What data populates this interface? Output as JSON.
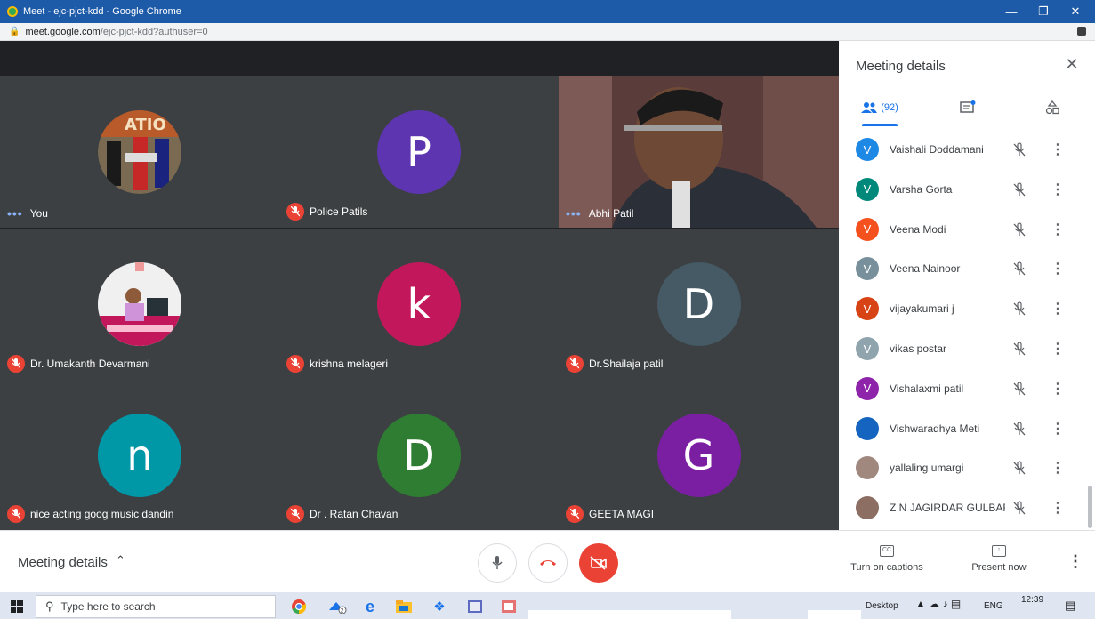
{
  "browser": {
    "window_title": "Meet - ejc-pjct-kdd - Google Chrome",
    "url_host": "meet.google.com",
    "url_path": "/ejc-pjct-kdd?authuser=0"
  },
  "tiles": [
    {
      "name": "You",
      "kind": "photo",
      "status": "talking"
    },
    {
      "name": "Police Patils",
      "kind": "letter",
      "letter": "P",
      "color": "#5e35b1",
      "status": "muted"
    },
    {
      "name": "Abhi Patil",
      "kind": "video",
      "status": "talking"
    },
    {
      "name": "Dr. Umakanth Devarmani",
      "kind": "photo",
      "status": "muted"
    },
    {
      "name": "krishna melageri",
      "kind": "letter",
      "letter": "k",
      "color": "#c2185b",
      "status": "muted"
    },
    {
      "name": "Dr.Shailaja patil",
      "kind": "letter",
      "letter": "D",
      "color": "#455a64",
      "status": "muted"
    },
    {
      "name": "nice acting goog music dandin",
      "kind": "letter",
      "letter": "n",
      "color": "#0097a7",
      "status": "muted"
    },
    {
      "name": "Dr . Ratan Chavan",
      "kind": "letter",
      "letter": "D",
      "color": "#2e7d32",
      "status": "muted"
    },
    {
      "name": "GEETA MAGI",
      "kind": "letter",
      "letter": "G",
      "color": "#7b1fa2",
      "status": "muted"
    }
  ],
  "panel": {
    "title": "Meeting details",
    "people_count": "(92)",
    "participants": [
      {
        "name": "Vaishali Doddamani",
        "letter": "V",
        "color": "#1e88e5"
      },
      {
        "name": "Varsha Gorta",
        "letter": "V",
        "color": "#00897b"
      },
      {
        "name": "Veena Modi",
        "letter": "V",
        "color": "#f4511e"
      },
      {
        "name": "Veena Nainoor",
        "letter": "V",
        "color": "#78909c"
      },
      {
        "name": "vijayakumari j",
        "letter": "V",
        "color": "#d84315"
      },
      {
        "name": "vikas postar",
        "letter": "V",
        "color": "#90a4ae"
      },
      {
        "name": "Vishalaxmi patil",
        "letter": "V",
        "color": "#8e24aa"
      },
      {
        "name": "Vishwaradhya Meti",
        "letter": "",
        "color": "#1565c0"
      },
      {
        "name": "yallaling umargi",
        "letter": "",
        "color": "#a1887f"
      },
      {
        "name": "Z N JAGIRDAR GULBAR...",
        "letter": "",
        "color": "#8d6e63"
      }
    ]
  },
  "bottom": {
    "meeting_details": "Meeting details",
    "captions_label": "Turn on captions",
    "captions_icon": "CC",
    "present_label": "Present now"
  },
  "taskbar": {
    "search_placeholder": "Type here to search",
    "desktop_label": "Desktop",
    "lang": "ENG",
    "time": "12:39",
    "badge": "2"
  }
}
